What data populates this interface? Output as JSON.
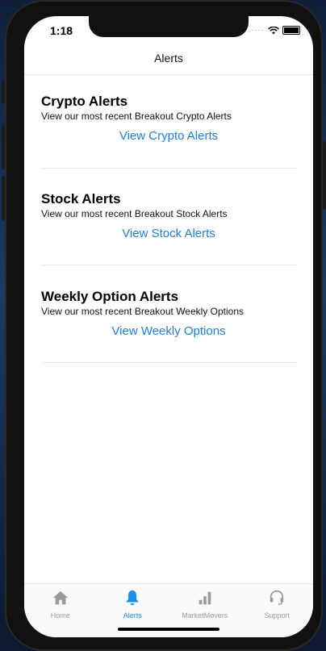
{
  "status_bar": {
    "time": "1:18"
  },
  "nav": {
    "title": "Alerts"
  },
  "sections": [
    {
      "title": "Crypto Alerts",
      "description": "View our most recent Breakout Crypto Alerts",
      "link": "View Crypto Alerts"
    },
    {
      "title": "Stock Alerts",
      "description": "View our most recent Breakout Stock Alerts",
      "link": "View Stock Alerts"
    },
    {
      "title": "Weekly Option Alerts",
      "description": "View our most recent Breakout Weekly Options",
      "link": "View Weekly Options"
    }
  ],
  "tabs": [
    {
      "label": "Home",
      "icon": "home-icon"
    },
    {
      "label": "Alerts",
      "icon": "bell-icon",
      "active": true
    },
    {
      "label": "MarketMovers",
      "icon": "bar-chart-icon"
    },
    {
      "label": "Support",
      "icon": "headset-icon"
    }
  ],
  "colors": {
    "accent": "#1a8ee8",
    "link": "#1a7ee0",
    "tab_inactive": "#9b9b9b"
  }
}
